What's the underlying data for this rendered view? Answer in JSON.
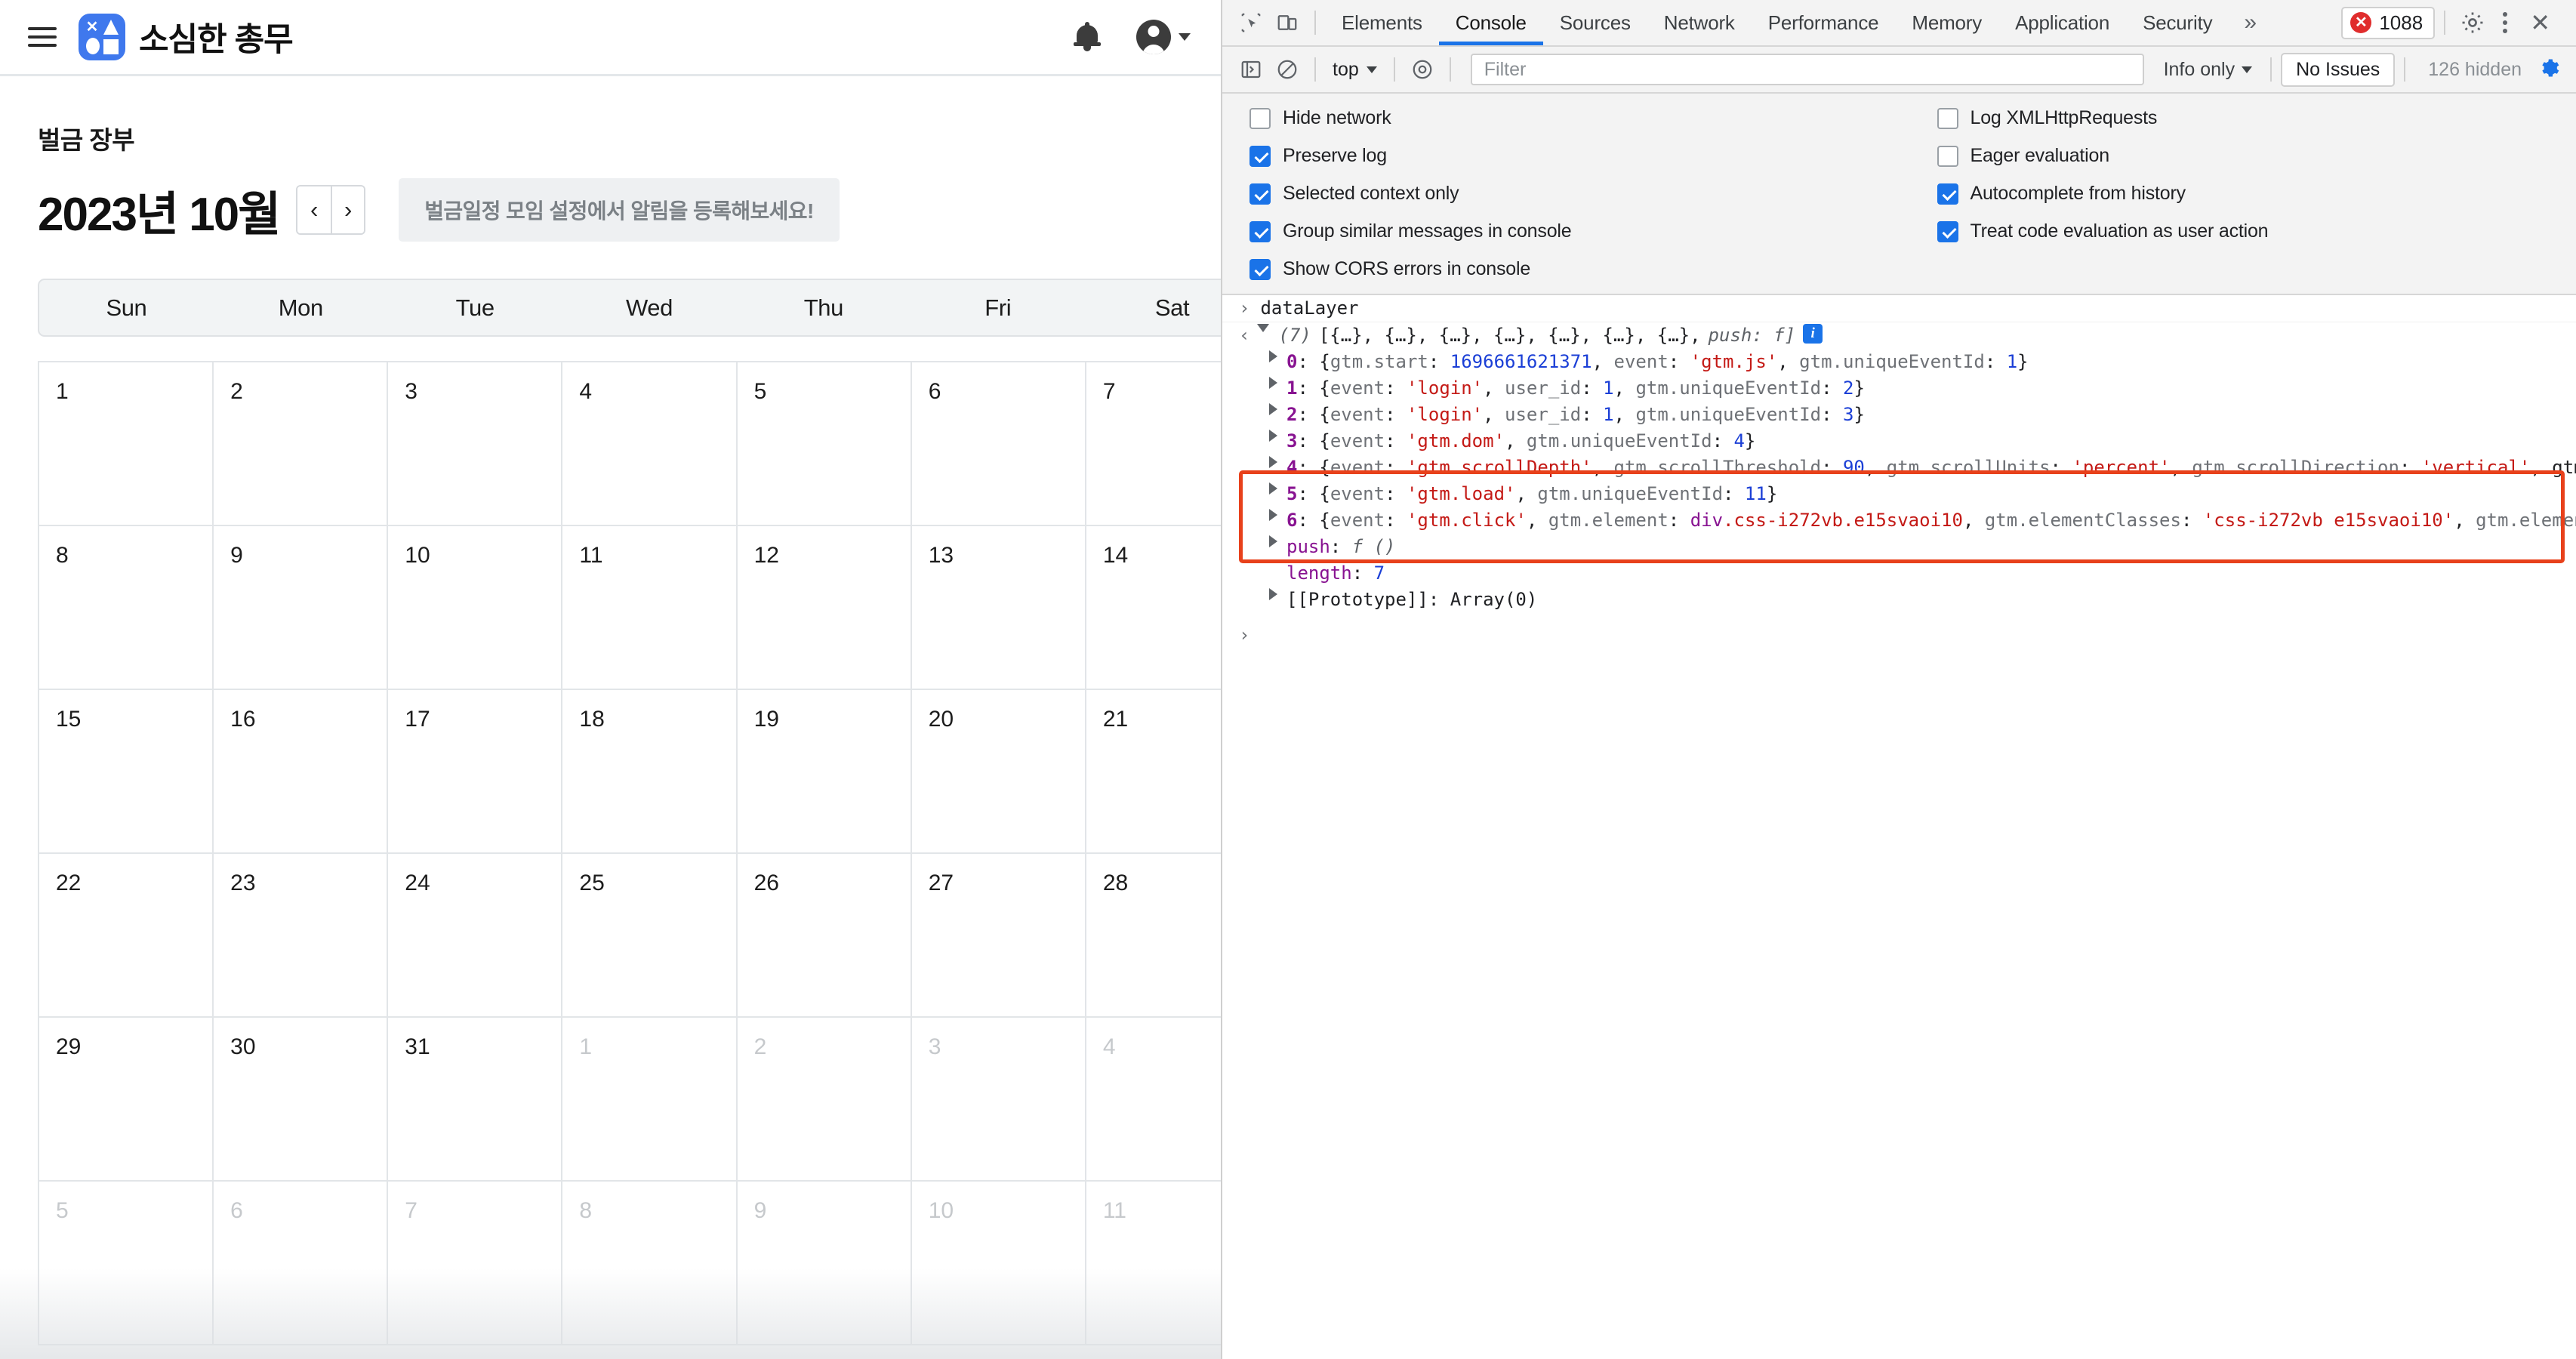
{
  "app": {
    "menu_icon": "hamburger-icon",
    "brand_title": "소심한 총무",
    "bell_icon": "notification-bell-icon",
    "avatar_icon": "user-avatar-icon",
    "page_title": "벌금 장부",
    "month_label": "2023년 10월",
    "prev_label": "‹",
    "next_label": "›",
    "notice": "벌금일정  모임 설정에서 알림을 등록해보세요!",
    "weekdays": [
      "Sun",
      "Mon",
      "Tue",
      "Wed",
      "Thu",
      "Fri",
      "Sat"
    ],
    "weeks": [
      [
        {
          "d": "1",
          "out": false
        },
        {
          "d": "2",
          "out": false
        },
        {
          "d": "3",
          "out": false
        },
        {
          "d": "4",
          "out": false
        },
        {
          "d": "5",
          "out": false
        },
        {
          "d": "6",
          "out": false
        },
        {
          "d": "7",
          "out": false
        }
      ],
      [
        {
          "d": "8",
          "out": false
        },
        {
          "d": "9",
          "out": false
        },
        {
          "d": "10",
          "out": false
        },
        {
          "d": "11",
          "out": false
        },
        {
          "d": "12",
          "out": false
        },
        {
          "d": "13",
          "out": false
        },
        {
          "d": "14",
          "out": false
        }
      ],
      [
        {
          "d": "15",
          "out": false
        },
        {
          "d": "16",
          "out": false
        },
        {
          "d": "17",
          "out": false
        },
        {
          "d": "18",
          "out": false
        },
        {
          "d": "19",
          "out": false
        },
        {
          "d": "20",
          "out": false
        },
        {
          "d": "21",
          "out": false
        }
      ],
      [
        {
          "d": "22",
          "out": false
        },
        {
          "d": "23",
          "out": false
        },
        {
          "d": "24",
          "out": false
        },
        {
          "d": "25",
          "out": false
        },
        {
          "d": "26",
          "out": false
        },
        {
          "d": "27",
          "out": false
        },
        {
          "d": "28",
          "out": false
        }
      ],
      [
        {
          "d": "29",
          "out": false
        },
        {
          "d": "30",
          "out": false
        },
        {
          "d": "31",
          "out": false
        },
        {
          "d": "1",
          "out": true
        },
        {
          "d": "2",
          "out": true
        },
        {
          "d": "3",
          "out": true
        },
        {
          "d": "4",
          "out": true
        }
      ],
      [
        {
          "d": "5",
          "out": true
        },
        {
          "d": "6",
          "out": true
        },
        {
          "d": "7",
          "out": true
        },
        {
          "d": "8",
          "out": true
        },
        {
          "d": "9",
          "out": true
        },
        {
          "d": "10",
          "out": true
        },
        {
          "d": "11",
          "out": true
        }
      ]
    ]
  },
  "devtools": {
    "inspect_icon": "inspect-element-icon",
    "device_icon": "device-toolbar-icon",
    "tabs": [
      {
        "label": "Elements",
        "active": false
      },
      {
        "label": "Console",
        "active": true
      },
      {
        "label": "Sources",
        "active": false
      },
      {
        "label": "Network",
        "active": false
      },
      {
        "label": "Performance",
        "active": false
      },
      {
        "label": "Memory",
        "active": false
      },
      {
        "label": "Application",
        "active": false
      },
      {
        "label": "Security",
        "active": false
      }
    ],
    "more_tabs": "»",
    "error_count": "1088",
    "error_icon": "error-circle-icon",
    "settings_icon": "gear-icon",
    "kebab_icon": "more-options-icon",
    "close_icon": "close-icon",
    "console_toolbar": {
      "sidebar_icon": "console-sidebar-icon",
      "clear_icon": "clear-console-icon",
      "context": "top",
      "eye_icon": "live-expression-icon",
      "filter_placeholder": "Filter",
      "filter_value": "",
      "level": "Info only",
      "issues": "No Issues",
      "hidden": "126 hidden",
      "settings_icon": "console-settings-gear-icon"
    },
    "settings_left": [
      {
        "label": "Hide network",
        "checked": false
      },
      {
        "label": "Preserve log",
        "checked": true
      },
      {
        "label": "Selected context only",
        "checked": true
      },
      {
        "label": "Group similar messages in console",
        "checked": true
      },
      {
        "label": "Show CORS errors in console",
        "checked": true
      }
    ],
    "settings_right": [
      {
        "label": "Log XMLHttpRequests",
        "checked": false
      },
      {
        "label": "Eager evaluation",
        "checked": false
      },
      {
        "label": "Autocomplete from history",
        "checked": true
      },
      {
        "label": "Treat code evaluation as user action",
        "checked": true
      }
    ],
    "console": {
      "input_expression": "dataLayer",
      "result_summary": "(7) [{…}, {…}, {…}, {…}, {…}, {…}, {…}, push: f]",
      "result_count": "(7)",
      "result_items": "[{…}, {…}, {…}, {…}, {…}, {…}, {…},",
      "result_push": "push: f]",
      "info_badge": "i",
      "entries": [
        {
          "index": "0",
          "text": "{gtm.start: 1696661621371, event: 'gtm.js', gtm.uniqueEventId: 1}"
        },
        {
          "index": "1",
          "text": "{event: 'login', user_id: 1, gtm.uniqueEventId: 2}"
        },
        {
          "index": "2",
          "text": "{event: 'login', user_id: 1, gtm.uniqueEventId: 3}"
        },
        {
          "index": "3",
          "text": "{event: 'gtm.dom', gtm.uniqueEventId: 4}"
        },
        {
          "index": "4",
          "text": "{event: 'gtm.scrollDepth', gtm.scrollThreshold: 90, gtm.scrollUnits: 'percent', gtm.scrollDirection: 'vertical', gtm.trigger"
        },
        {
          "index": "5",
          "text": "{event: 'gtm.load', gtm.uniqueEventId: 11}"
        },
        {
          "index": "6",
          "text": "{event: 'gtm.click', gtm.element: div.css-i272vb.e15svaoi10, gtm.elementClasses: 'css-i272vb e15svaoi10', gtm.elementId: ''"
        }
      ],
      "push_line": "push: f ()",
      "length_key": "length",
      "length_value": "7",
      "prototype_line": "[[Prototype]]: Array(0)",
      "prompt": "›",
      "highlight_color": "#e8411b"
    }
  }
}
